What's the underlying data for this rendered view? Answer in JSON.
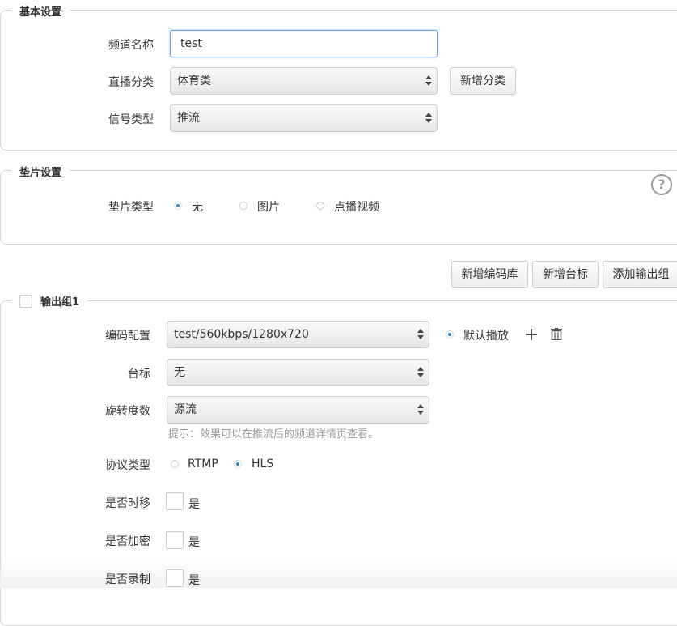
{
  "basic": {
    "legend": "基本设置",
    "channel_name_label": "频道名称",
    "channel_name_value": "test",
    "category_label": "直播分类",
    "category_value": "体育类",
    "add_category": "新增分类",
    "signal_label": "信号类型",
    "signal_value": "推流"
  },
  "pad": {
    "legend": "垫片设置",
    "type_label": "垫片类型",
    "options": [
      "无",
      "图片",
      "点播视频"
    ],
    "selected": "无",
    "help": "?"
  },
  "toolbar": {
    "add_codec": "新增编码库",
    "add_logo": "新增台标",
    "add_output": "添加输出组"
  },
  "output": {
    "legend": "输出组1",
    "codec_label": "编码配置",
    "codec_value": "test/560kbps/1280x720",
    "default_play": "默认播放",
    "logo_label": "台标",
    "logo_value": "无",
    "rotate_label": "旋转度数",
    "rotate_value": "源流",
    "rotate_hint": "提示：效果可以在推流后的频道详情页查看。",
    "protocol_label": "协议类型",
    "protocol_options": [
      "RTMP",
      "HLS"
    ],
    "protocol_selected": "HLS",
    "timeshift_label": "是否时移",
    "encrypt_label": "是否加密",
    "record_label": "是否录制",
    "yes": "是"
  },
  "colors": {
    "accent": "#2a8bd6",
    "border": "#d6d6d6",
    "hint": "#999999"
  }
}
